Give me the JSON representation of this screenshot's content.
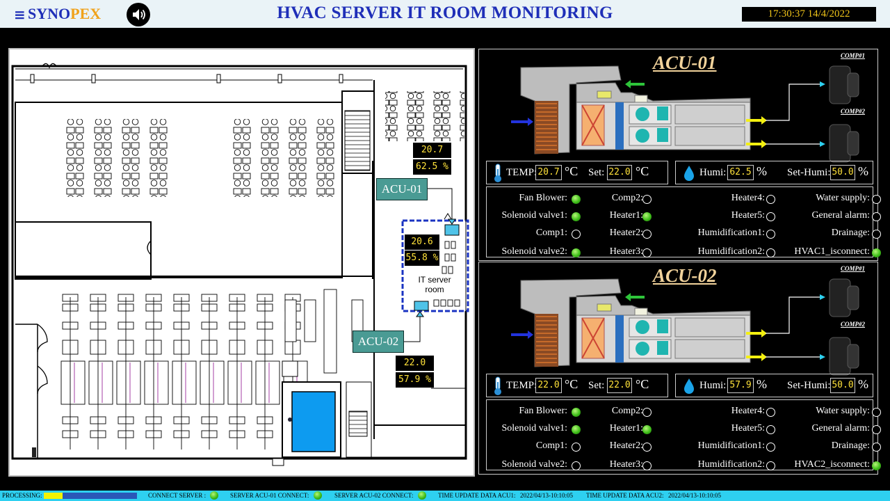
{
  "header": {
    "logo_part1": "SYNO",
    "logo_part2": "PEX",
    "title": "HVAC SERVER IT ROOM MONITORING",
    "clock": "17:30:37 14/4/2022"
  },
  "floorplan": {
    "room_label": "IT server room",
    "acu01_tag": "ACU-01",
    "acu02_tag": "ACU-02",
    "readouts": {
      "top_temp": "20.7 °C",
      "top_humi": "62.5 %",
      "room_temp": "20.6 °C",
      "room_humi": "55.8 %",
      "bottom_temp": "22.0 °C",
      "bottom_humi": "57.9 %"
    }
  },
  "acu": [
    {
      "title": "ACU-01",
      "comp1_label": "COMP#1",
      "comp2_label": "COMP#2",
      "temp_label": "TEMP:",
      "temp": "20.7",
      "set_label": "Set:",
      "set": "22.0",
      "deg_unit": "°C",
      "humi_label": "Humi:",
      "humi": "62.5",
      "set_humi_label": "Set-Humi:",
      "set_humi": "50.0",
      "pct_unit": "%",
      "status": [
        {
          "label": "Fan Blower:",
          "on": true
        },
        {
          "label": "Comp2:",
          "on": false
        },
        {
          "label": "Heater4:",
          "on": false
        },
        {
          "label": "Water supply:",
          "on": false
        },
        {
          "label": "Solenoid valve1:",
          "on": true
        },
        {
          "label": "Heater1:",
          "on": true
        },
        {
          "label": "Heater5:",
          "on": false
        },
        {
          "label": "General alarm:",
          "on": false
        },
        {
          "label": "Comp1:",
          "on": false
        },
        {
          "label": "Heater2:",
          "on": false
        },
        {
          "label": "Humidification1:",
          "on": false
        },
        {
          "label": "Drainage:",
          "on": false
        },
        {
          "label": "Solenoid valve2:",
          "on": true
        },
        {
          "label": "Heater3:",
          "on": false
        },
        {
          "label": "Humidification2:",
          "on": false
        },
        {
          "label": "HVAC1_isconnect:",
          "on": true
        }
      ]
    },
    {
      "title": "ACU-02",
      "comp1_label": "COMP#1",
      "comp2_label": "COMP#2",
      "temp_label": "TEMP:",
      "temp": "22.0",
      "set_label": "Set:",
      "set": "22.0",
      "deg_unit": "°C",
      "humi_label": "Humi:",
      "humi": "57.9",
      "set_humi_label": "Set-Humi:",
      "set_humi": "50.0",
      "pct_unit": "%",
      "status": [
        {
          "label": "Fan Blower:",
          "on": true
        },
        {
          "label": "Comp2:",
          "on": false
        },
        {
          "label": "Heater4:",
          "on": false
        },
        {
          "label": "Water supply:",
          "on": false
        },
        {
          "label": "Solenoid valve1:",
          "on": true
        },
        {
          "label": "Heater1:",
          "on": true
        },
        {
          "label": "Heater5:",
          "on": false
        },
        {
          "label": "General alarm:",
          "on": false
        },
        {
          "label": "Comp1:",
          "on": false
        },
        {
          "label": "Heater2:",
          "on": false
        },
        {
          "label": "Humidification1:",
          "on": false
        },
        {
          "label": "Drainage:",
          "on": false
        },
        {
          "label": "Solenoid valve2:",
          "on": false
        },
        {
          "label": "Heater3:",
          "on": false
        },
        {
          "label": "Humidification2:",
          "on": false
        },
        {
          "label": "HVAC2_isconnect:",
          "on": true
        }
      ]
    }
  ],
  "statusbar": {
    "processing_label": "PROCESSING:",
    "processing_fraction": 0.2,
    "connect_server": "CONNECT SERVER :",
    "acu01_connect": "SERVER ACU-01 CONNECT:",
    "acu02_connect": "SERVER ACU-02 CONNECT:",
    "time_acu1_label": "TIME UPDATE DATA ACU1:",
    "time_acu1": "2022/04/13-10:10:05",
    "time_acu2_label": "TIME UPDATE DATA ACU2:",
    "time_acu2": "2022/04/13-10:10:05"
  },
  "colors": {
    "title_blue": "#1f2fb8",
    "logo_orange": "#f0a21b",
    "readout_yellow": "#ffe23a",
    "led_on": "#3fbf1a",
    "statusbar": "#2ed0f0",
    "acu_tag": "#4a9b94"
  }
}
